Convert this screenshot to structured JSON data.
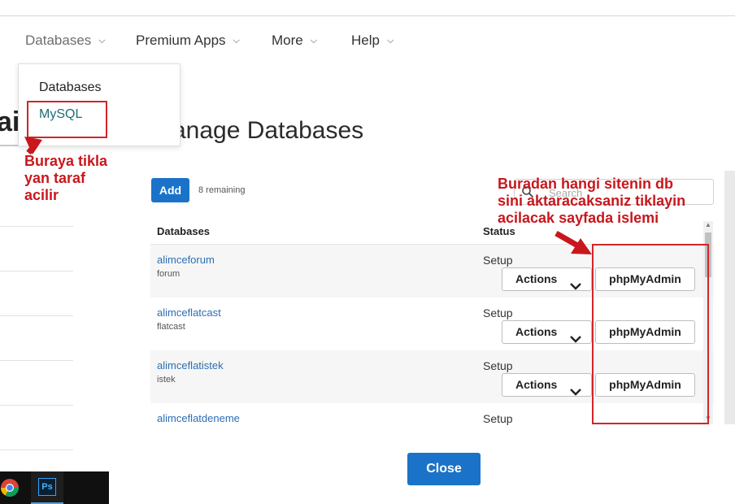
{
  "nav": {
    "items": [
      {
        "label": "Databases"
      },
      {
        "label": "Premium Apps"
      },
      {
        "label": "More"
      },
      {
        "label": "Help"
      }
    ]
  },
  "background": {
    "title_fragment": "ai"
  },
  "dropdown": {
    "items": [
      {
        "label": "Databases"
      },
      {
        "label": "MySQL"
      }
    ]
  },
  "modal": {
    "title": "Manage Databases",
    "add_label": "Add",
    "remaining": "8 remaining",
    "search_placeholder": "Search",
    "columns": {
      "databases": "Databases",
      "status": "Status"
    },
    "rows": [
      {
        "name": "alimceforum",
        "sub": "forum",
        "status": "Setup",
        "actions": "Actions",
        "pma": "phpMyAdmin"
      },
      {
        "name": "alimceflatcast",
        "sub": "flatcast",
        "status": "Setup",
        "actions": "Actions",
        "pma": "phpMyAdmin"
      },
      {
        "name": "alimceflatistek",
        "sub": "istek",
        "status": "Setup",
        "actions": "Actions",
        "pma": "phpMyAdmin"
      },
      {
        "name": "alimceflatdeneme",
        "sub": "",
        "status": "Setup",
        "actions": "",
        "pma": ""
      }
    ],
    "close_label": "Close"
  },
  "annotations": {
    "left": [
      "Buraya tikla",
      "yan taraf",
      "acilir"
    ],
    "right": [
      "Buradan hangi sitenin db",
      "sini aktaracaksaniz tiklayin",
      "acilacak sayfada islemi"
    ]
  },
  "taskbar": {
    "ps_label": "Ps"
  },
  "colors": {
    "accent": "#1a73c8",
    "link": "#2b6fb5",
    "annotation": "#c8171d"
  }
}
